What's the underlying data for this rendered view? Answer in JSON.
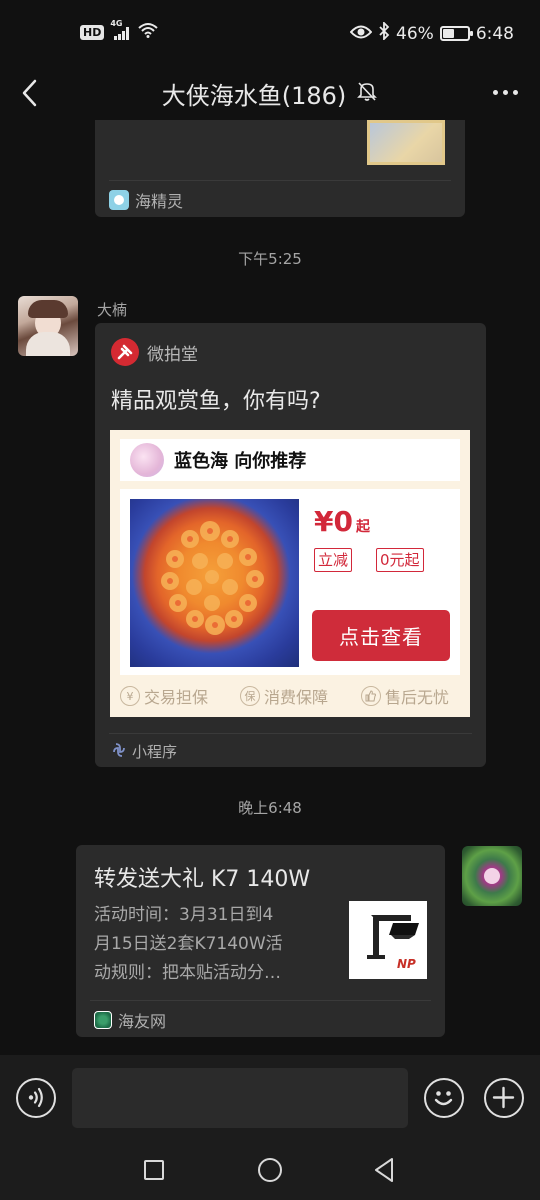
{
  "status_bar": {
    "network_hd": "HD",
    "network_gen": "4G",
    "battery_percent": "46%",
    "battery_level": 0.46,
    "time": "6:48"
  },
  "header": {
    "title": "大侠海水鱼(186)",
    "icons": {
      "back": "chevron-left-icon",
      "mute": "bell-off-icon",
      "more": "more-dots-icon"
    }
  },
  "messages": [
    {
      "type": "link_card_partial",
      "source": "海精灵"
    },
    {
      "type": "time",
      "text": "下午5:25"
    },
    {
      "type": "mini_program",
      "sender": "大楠",
      "app_name": "微拍堂",
      "title": "精品观赏鱼，你有吗?",
      "shop_line": "蓝色海 向你推荐",
      "price": "¥0",
      "price_suffix": "起",
      "tags": [
        "立减",
        "0元起"
      ],
      "cta": "点击查看",
      "guarantees": [
        {
          "icon_char": "¥",
          "label": "交易担保"
        },
        {
          "icon_char": "保",
          "label": "消费保障"
        },
        {
          "icon_char": "👍",
          "label": "售后无忧"
        }
      ],
      "footer": "小程序"
    },
    {
      "type": "time",
      "text": "晚上6:48"
    },
    {
      "type": "link_card",
      "outgoing": true,
      "title": "转发送大礼 K7 140W",
      "desc_lines": [
        "活动时间：3月31日到4",
        "月15日送2套K7140W活",
        "动规则：把本贴活动分…"
      ],
      "thumb_text": "NP",
      "source": "海友网"
    }
  ],
  "input_bar": {
    "placeholder": "",
    "icons": {
      "voice": "voice-icon",
      "emoji": "emoji-icon",
      "plus": "plus-icon"
    }
  },
  "nav_bar": {
    "icons": [
      "recent-apps-icon",
      "home-icon",
      "back-triangle-icon"
    ]
  },
  "colors": {
    "background": "#111111",
    "card": "#2b2b2b",
    "accent_red": "#cf2c3a"
  }
}
